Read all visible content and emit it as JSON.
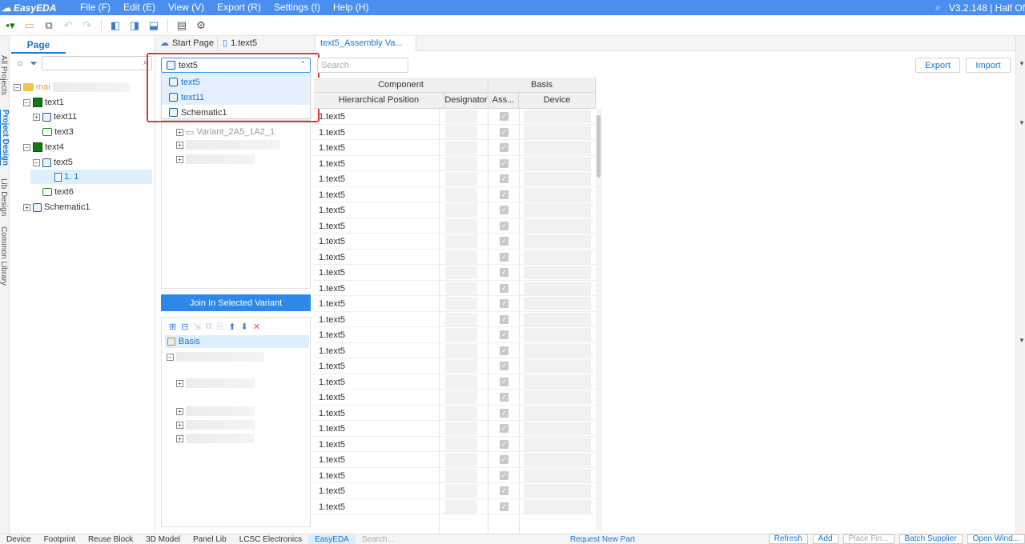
{
  "app": {
    "logo_text": "EasyEDA",
    "version_text": "V3.2.148 | Half Of",
    "menus": [
      "File (F)",
      "Edit (E)",
      "View (V)",
      "Export (R)",
      "Settings (I)",
      "Help (H)"
    ]
  },
  "left_tabs": [
    "All Projects",
    "Project Design",
    "Lib Design",
    "Common Library"
  ],
  "left_panel": {
    "tab_label": "Page",
    "tree": [
      {
        "label": "mai",
        "icon": "folder-icon",
        "level": 0,
        "toggle": "−"
      },
      {
        "label": "text1",
        "icon": "pcb-icon",
        "level": 1,
        "toggle": "−"
      },
      {
        "label": "text11",
        "icon": "schematic-icon",
        "level": 2,
        "toggle": "+"
      },
      {
        "label": "text3",
        "icon": "panel-icon",
        "level": 2,
        "toggle": ""
      },
      {
        "label": "text4",
        "icon": "pcb-icon",
        "level": 1,
        "toggle": "−"
      },
      {
        "label": "text5",
        "icon": "schematic-icon",
        "level": 2,
        "toggle": "−"
      },
      {
        "label": "1. 1",
        "icon": "page-icon",
        "level": 3,
        "toggle": ""
      },
      {
        "label": "text6",
        "icon": "panel-icon",
        "level": 2,
        "toggle": ""
      },
      {
        "label": "Schematic1",
        "icon": "schematic-icon",
        "level": 1,
        "toggle": "+"
      }
    ]
  },
  "editor_tabs": [
    {
      "label": "Start Page",
      "icon": "cloud-icon"
    },
    {
      "label": "1.text5",
      "icon": "page-icon"
    },
    {
      "label": "text5_Assembly Va...",
      "icon": ""
    }
  ],
  "variant": {
    "selected": "text5",
    "options": [
      "text5",
      "text11",
      "Schematic1"
    ],
    "list_item": "Variant_2A5_1A2_1",
    "join_button": "Join In Selected Variant",
    "basis_label": "Basis"
  },
  "grid": {
    "search_placeholder": "Search",
    "export_label": "Export",
    "import_label": "Import",
    "group_component": "Component",
    "group_basis": "Basis",
    "col_position": "Hierarchical Position",
    "col_designator": "Designator",
    "col_assembly": "Ass...",
    "col_device": "Device",
    "rows": [
      "1.text5",
      "1.text5",
      "1.text5",
      "1.text5",
      "1.text5",
      "1.text5",
      "1.text5",
      "1.text5",
      "1.text5",
      "1.text5",
      "1.text5",
      "1.text5",
      "1.text5",
      "1.text5",
      "1.text5",
      "1.text5",
      "1.text5",
      "1.text5",
      "1.text5",
      "1.text5",
      "1.text5",
      "1.text5",
      "1.text5",
      "1.text5",
      "1.text5",
      "1.text5"
    ]
  },
  "bottom": {
    "tabs": [
      "Device",
      "Footprint",
      "Reuse Block",
      "3D Model",
      "Panel Lib",
      "LCSC Electronics",
      "EasyEDA",
      "Search..."
    ],
    "request_link": "Request New Part",
    "buttons": [
      "Refresh",
      "Add",
      "Place Fin...",
      "Batch Supplier",
      "Open Wind..."
    ]
  },
  "colors": {
    "accent": "#1976d2",
    "menubar": "#4a8ff0",
    "highlight": "#d9393c"
  }
}
